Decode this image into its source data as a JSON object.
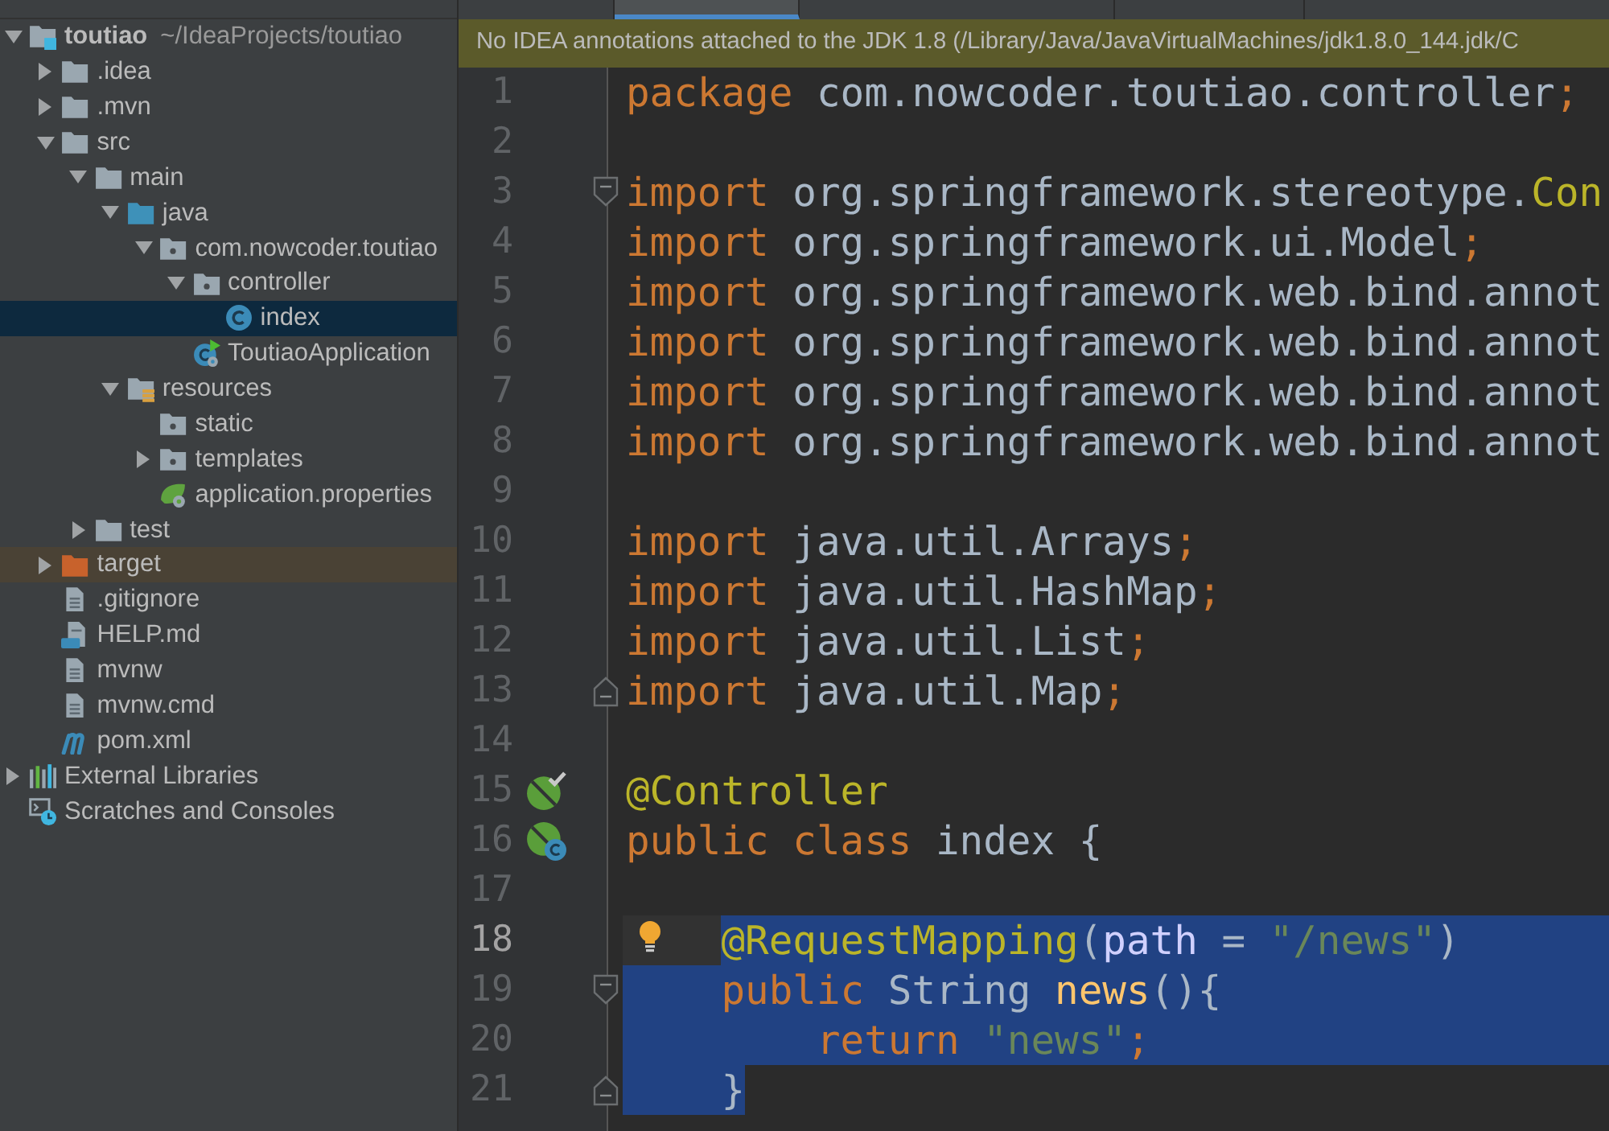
{
  "project_tree": [
    {
      "label": "toutiao",
      "path": "~/IdeaProjects/toutiao",
      "kind": "module",
      "expanded": true,
      "selected": false,
      "highlighted": false,
      "children": [
        {
          "label": ".idea",
          "kind": "folder",
          "expanded": false,
          "selected": false,
          "highlighted": false
        },
        {
          "label": ".mvn",
          "kind": "folder",
          "expanded": false,
          "selected": false,
          "highlighted": false
        },
        {
          "label": "src",
          "kind": "folder",
          "expanded": true,
          "selected": false,
          "highlighted": false,
          "children": [
            {
              "label": "main",
              "kind": "folder",
              "expanded": true,
              "selected": false,
              "highlighted": false,
              "children": [
                {
                  "label": "java",
                  "kind": "source-root",
                  "expanded": true,
                  "selected": false,
                  "highlighted": false,
                  "children": [
                    {
                      "label": "com.nowcoder.toutiao",
                      "kind": "package",
                      "expanded": true,
                      "selected": false,
                      "highlighted": false,
                      "children": [
                        {
                          "label": "controller",
                          "kind": "package",
                          "expanded": true,
                          "selected": false,
                          "highlighted": false,
                          "children": [
                            {
                              "label": "index",
                              "kind": "class",
                              "selected": true,
                              "highlighted": false
                            }
                          ]
                        },
                        {
                          "label": "ToutiaoApplication",
                          "kind": "boot-class",
                          "selected": false,
                          "highlighted": false
                        }
                      ]
                    }
                  ]
                },
                {
                  "label": "resources",
                  "kind": "resources-root",
                  "expanded": true,
                  "selected": false,
                  "highlighted": false,
                  "children": [
                    {
                      "label": "static",
                      "kind": "package",
                      "selected": false,
                      "highlighted": false
                    },
                    {
                      "label": "templates",
                      "kind": "package",
                      "expanded": false,
                      "selected": false,
                      "highlighted": false
                    },
                    {
                      "label": "application.properties",
                      "kind": "spring-config",
                      "selected": false,
                      "highlighted": false
                    }
                  ]
                }
              ]
            },
            {
              "label": "test",
              "kind": "folder",
              "expanded": false,
              "selected": false,
              "highlighted": false
            }
          ]
        },
        {
          "label": "target",
          "kind": "excluded",
          "expanded": false,
          "selected": false,
          "highlighted": true
        },
        {
          "label": ".gitignore",
          "kind": "text-file",
          "selected": false,
          "highlighted": false
        },
        {
          "label": "HELP.md",
          "kind": "markdown",
          "selected": false,
          "highlighted": false
        },
        {
          "label": "mvnw",
          "kind": "text-file",
          "selected": false,
          "highlighted": false
        },
        {
          "label": "mvnw.cmd",
          "kind": "text-file",
          "selected": false,
          "highlighted": false
        },
        {
          "label": "pom.xml",
          "kind": "maven",
          "selected": false,
          "highlighted": false
        }
      ]
    },
    {
      "label": "External Libraries",
      "kind": "libraries",
      "expanded": false,
      "selected": false,
      "highlighted": false
    },
    {
      "label": "Scratches and Consoles",
      "kind": "scratches",
      "selected": false,
      "highlighted": false
    }
  ],
  "editor_tabs": [
    {
      "selected": false
    },
    {
      "selected": true
    },
    {
      "selected": false
    },
    {
      "selected": false
    }
  ],
  "notification": {
    "text": "No IDEA annotations attached to the JDK 1.8 (/Library/Java/JavaVirtualMachines/jdk1.8.0_144.jdk/C"
  },
  "editor": {
    "lines": [
      {
        "number": "1",
        "current": false,
        "tokens": [
          {
            "kind": "keyword",
            "text": "package"
          },
          {
            "kind": "plain",
            "text": " com.nowcoder.toutiao.controller"
          },
          {
            "kind": "keyword",
            "text": ";"
          }
        ]
      },
      {
        "number": "2",
        "current": false
      },
      {
        "number": "3",
        "current": false,
        "fold_start": true,
        "tokens": [
          {
            "kind": "keyword",
            "text": "import"
          },
          {
            "kind": "plain",
            "text": " org.springframework.stereotype."
          },
          {
            "kind": "annotation",
            "text": "Con"
          }
        ]
      },
      {
        "number": "4",
        "current": false,
        "tokens": [
          {
            "kind": "keyword",
            "text": "import"
          },
          {
            "kind": "plain",
            "text": " org.springframework.ui.Model"
          },
          {
            "kind": "keyword",
            "text": ";"
          }
        ]
      },
      {
        "number": "5",
        "current": false,
        "tokens": [
          {
            "kind": "keyword",
            "text": "import"
          },
          {
            "kind": "plain",
            "text": " org.springframework.web.bind.annot"
          }
        ]
      },
      {
        "number": "6",
        "current": false,
        "tokens": [
          {
            "kind": "keyword",
            "text": "import"
          },
          {
            "kind": "plain",
            "text": " org.springframework.web.bind.annot"
          }
        ]
      },
      {
        "number": "7",
        "current": false,
        "tokens": [
          {
            "kind": "keyword",
            "text": "import"
          },
          {
            "kind": "plain",
            "text": " org.springframework.web.bind.annot"
          }
        ]
      },
      {
        "number": "8",
        "current": false,
        "tokens": [
          {
            "kind": "keyword",
            "text": "import"
          },
          {
            "kind": "plain",
            "text": " org.springframework.web.bind.annot"
          }
        ]
      },
      {
        "number": "9",
        "current": false
      },
      {
        "number": "10",
        "current": false,
        "tokens": [
          {
            "kind": "keyword",
            "text": "import"
          },
          {
            "kind": "plain",
            "text": " java.util.Arrays"
          },
          {
            "kind": "keyword",
            "text": ";"
          }
        ]
      },
      {
        "number": "11",
        "current": false,
        "tokens": [
          {
            "kind": "keyword",
            "text": "import"
          },
          {
            "kind": "plain",
            "text": " java.util.HashMap"
          },
          {
            "kind": "keyword",
            "text": ";"
          }
        ]
      },
      {
        "number": "12",
        "current": false,
        "tokens": [
          {
            "kind": "keyword",
            "text": "import"
          },
          {
            "kind": "plain",
            "text": " java.util.List"
          },
          {
            "kind": "keyword",
            "text": ";"
          }
        ]
      },
      {
        "number": "13",
        "current": false,
        "fold_end": true,
        "tokens": [
          {
            "kind": "keyword",
            "text": "import"
          },
          {
            "kind": "plain",
            "text": " java.util.Map"
          },
          {
            "kind": "keyword",
            "text": ";"
          }
        ]
      },
      {
        "number": "14",
        "current": false
      },
      {
        "number": "15",
        "current": false,
        "gutter_marker": {
          "kind": "bean-check"
        },
        "tokens": [
          {
            "kind": "annotation",
            "text": "@Controller"
          }
        ]
      },
      {
        "number": "16",
        "current": false,
        "gutter_marker": {
          "kind": "bean-class"
        },
        "tokens": [
          {
            "kind": "keyword",
            "text": "public class"
          },
          {
            "kind": "plain",
            "text": " index {"
          }
        ]
      },
      {
        "number": "17",
        "current": false
      },
      {
        "number": "18",
        "current": true,
        "selection": {
          "includes_indent": false,
          "to_edge": true
        },
        "bulb": true,
        "tokens": [
          {
            "kind": "annotation",
            "text": "    @RequestMapping"
          },
          {
            "kind": "plain",
            "text": "("
          },
          {
            "kind": "param",
            "text": "path"
          },
          {
            "kind": "plain",
            "text": " = "
          },
          {
            "kind": "string",
            "text": "\"/news\""
          },
          {
            "kind": "plain",
            "text": ")"
          }
        ]
      },
      {
        "number": "19",
        "current": false,
        "selection": {
          "includes_indent": true,
          "to_edge": true
        },
        "fold_start": true,
        "tokens": [
          {
            "kind": "keyword",
            "text": "    public"
          },
          {
            "kind": "plain",
            "text": " String "
          },
          {
            "kind": "method",
            "text": "news"
          },
          {
            "kind": "plain",
            "text": "(){"
          }
        ]
      },
      {
        "number": "20",
        "current": false,
        "selection": {
          "includes_indent": true,
          "to_edge": true
        },
        "tokens": [
          {
            "kind": "keyword",
            "text": "        return"
          },
          {
            "kind": "string",
            "text": " \"news\""
          },
          {
            "kind": "keyword",
            "text": ";"
          }
        ]
      },
      {
        "number": "21",
        "current": false,
        "selection": {
          "includes_indent": true,
          "to_edge": false
        },
        "fold_end": true,
        "tokens": [
          {
            "kind": "plain",
            "text": "    }"
          }
        ]
      }
    ]
  }
}
